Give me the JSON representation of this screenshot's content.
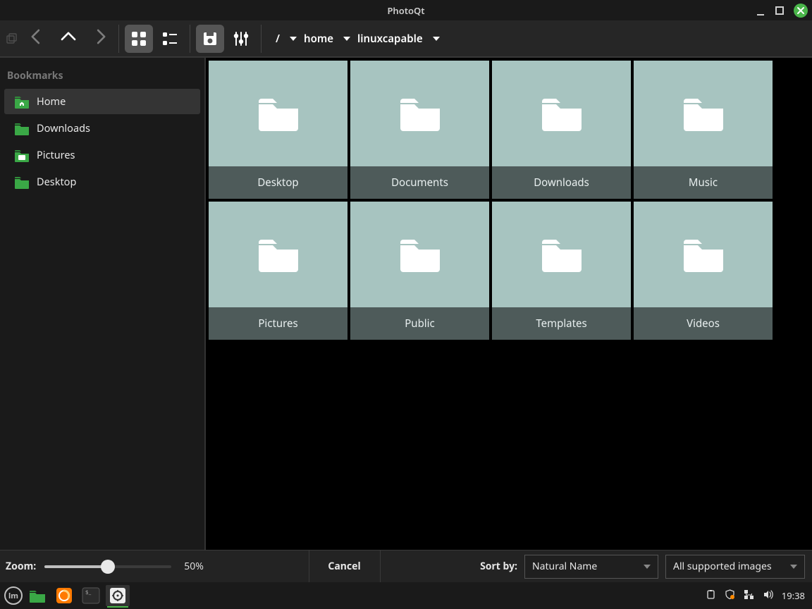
{
  "window": {
    "title": "PhotoQt"
  },
  "breadcrumbs": [
    {
      "label": "/"
    },
    {
      "label": "home"
    },
    {
      "label": "linuxcapable"
    }
  ],
  "sidebar": {
    "heading": "Bookmarks",
    "items": [
      {
        "label": "Home",
        "selected": true,
        "icon": "home"
      },
      {
        "label": "Downloads",
        "selected": false,
        "icon": "folder"
      },
      {
        "label": "Pictures",
        "selected": false,
        "icon": "picfolder"
      },
      {
        "label": "Desktop",
        "selected": false,
        "icon": "folder"
      }
    ]
  },
  "folders": [
    {
      "label": "Desktop"
    },
    {
      "label": "Documents"
    },
    {
      "label": "Downloads"
    },
    {
      "label": "Music"
    },
    {
      "label": "Pictures"
    },
    {
      "label": "Public"
    },
    {
      "label": "Templates"
    },
    {
      "label": "Videos"
    }
  ],
  "footer": {
    "zoom_label": "Zoom:",
    "zoom_value": "50%",
    "zoom_pct": 50,
    "cancel_label": "Cancel",
    "sort_label": "Sort by:",
    "sort_value": "Natural Name",
    "filter_value": "All supported images"
  },
  "taskbar": {
    "clock": "19:38"
  }
}
